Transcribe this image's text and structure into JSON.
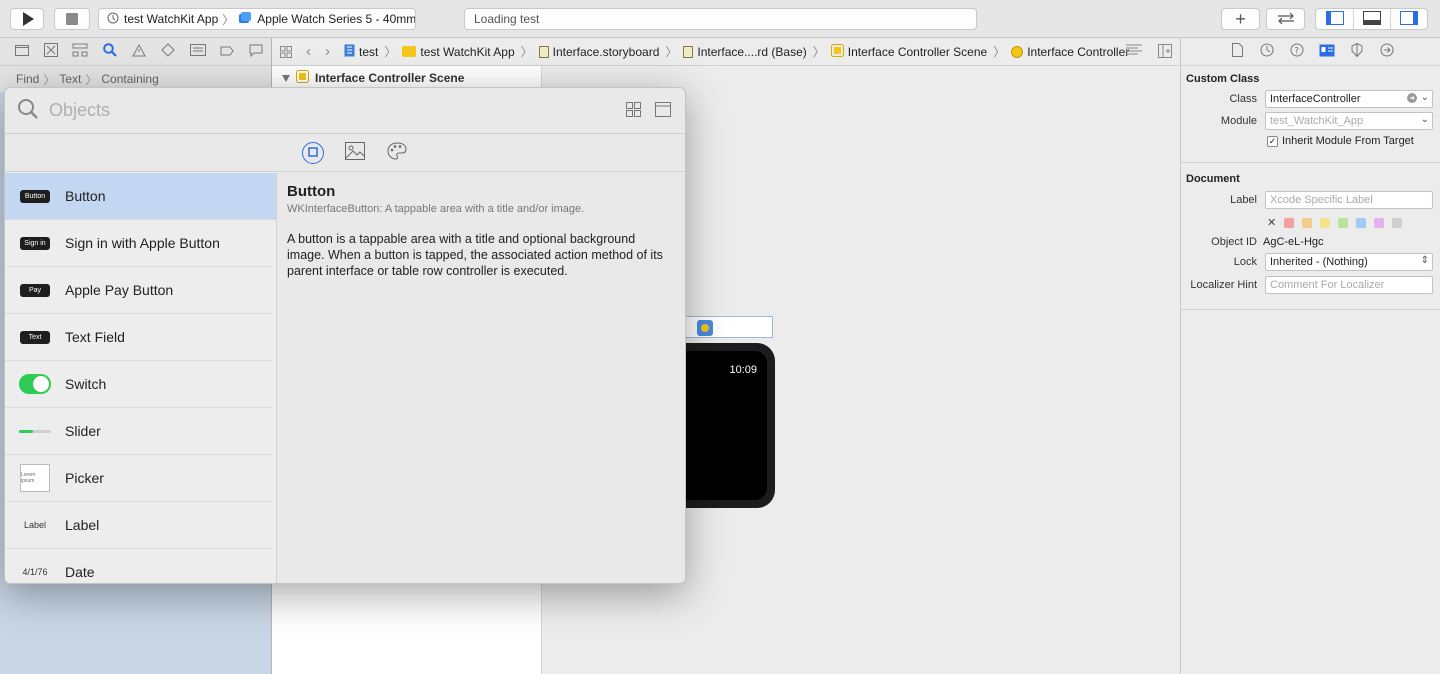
{
  "toolbar": {
    "scheme": {
      "target": "test WatchKit App",
      "device": "Apple Watch Series 5 - 40mm"
    },
    "activity_text": "Loading test"
  },
  "navigator": {
    "find_path": [
      "Find",
      "Text",
      "Containing"
    ]
  },
  "jumpbar": {
    "crumbs": [
      "test",
      "test WatchKit App",
      "Interface.storyboard",
      "Interface....rd (Base)",
      "Interface Controller Scene",
      "Interface Controller"
    ]
  },
  "outline": {
    "scene_label": "Interface Controller Scene"
  },
  "library": {
    "search_placeholder": "Objects",
    "items": [
      {
        "label": "Button",
        "thumb_text": "Button"
      },
      {
        "label": "Sign in with Apple Button",
        "thumb_text": "Sign in"
      },
      {
        "label": "Apple Pay Button",
        "thumb_text": "Pay"
      },
      {
        "label": "Text Field",
        "thumb_text": "Text"
      },
      {
        "label": "Switch"
      },
      {
        "label": "Slider",
        "level": 0.45
      },
      {
        "label": "Picker",
        "thumb_text": "Lorem ipsum"
      },
      {
        "label": "Label",
        "thumb_text": "Label"
      },
      {
        "label": "Date",
        "thumb_text": "4/1/76"
      }
    ],
    "detail": {
      "title": "Button",
      "subtitle": "WKInterfaceButton: A tappable area with a title and/or image.",
      "description": "A button is a tappable area with a title and optional background image. When a button is tapped, the associated action method of its parent interface or table row controller is executed."
    }
  },
  "canvas": {
    "watch_time": "10:09"
  },
  "inspector": {
    "custom_class": {
      "title": "Custom Class",
      "class_label": "Class",
      "class_value": "InterfaceController",
      "module_label": "Module",
      "module_placeholder": "test_WatchKit_App",
      "inherit_label": "Inherit Module From Target"
    },
    "document": {
      "title": "Document",
      "label_label": "Label",
      "label_placeholder": "Xcode Specific Label",
      "object_id_label": "Object ID",
      "object_id_value": "AgC-eL-Hgc",
      "lock_label": "Lock",
      "lock_value": "Inherited - (Nothing)",
      "hint_label": "Localizer Hint",
      "hint_placeholder": "Comment For Localizer",
      "swatch_colors": [
        "#f2a0a0",
        "#f7c98a",
        "#f3e48a",
        "#b9e39a",
        "#9fcdf2",
        "#e4b3ef",
        "#cfcfcf"
      ]
    }
  },
  "colors": {
    "accent": "#2a6ee6",
    "navigator_bg": "#c8d6e6",
    "switch_on": "#2ecc57"
  }
}
